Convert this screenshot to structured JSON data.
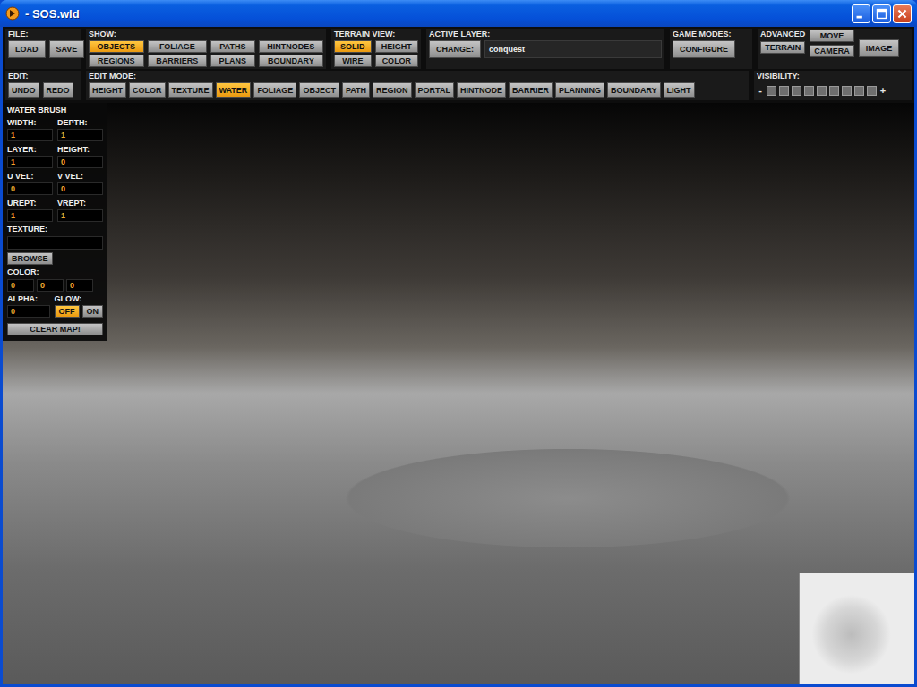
{
  "window": {
    "title": "- SOS.wld"
  },
  "toolbar": {
    "file": {
      "label": "FILE:",
      "buttons": [
        {
          "label": "LOAD"
        },
        {
          "label": "SAVE"
        }
      ]
    },
    "show": {
      "label": "SHOW:",
      "buttons": [
        {
          "label": "OBJECTS",
          "selected": true
        },
        {
          "label": "FOLIAGE",
          "selected": false
        },
        {
          "label": "PATHS",
          "selected": false
        },
        {
          "label": "HINTNODES",
          "selected": false
        },
        {
          "label": "REGIONS",
          "selected": false
        },
        {
          "label": "BARRIERS",
          "selected": false
        },
        {
          "label": "PLANS",
          "selected": false
        },
        {
          "label": "BOUNDARY",
          "selected": false
        }
      ]
    },
    "terrain_view": {
      "label": "TERRAIN VIEW:",
      "buttons": [
        {
          "label": "SOLID",
          "selected": true
        },
        {
          "label": "HEIGHT",
          "selected": false
        },
        {
          "label": "WIRE",
          "selected": false
        },
        {
          "label": "COLOR",
          "selected": false
        }
      ]
    },
    "active_layer": {
      "label": "ACTIVE LAYER:",
      "change": "CHANGE:",
      "value": "conquest"
    },
    "game_modes": {
      "label": "GAME MODES:",
      "button": "CONFIGURE"
    },
    "advanced": {
      "label": "ADVANCED",
      "terrain": "TERRAIN",
      "move": "MOVE",
      "camera": "CAMERA",
      "image": "IMAGE"
    },
    "edit": {
      "label": "EDIT:",
      "buttons": [
        {
          "label": "UNDO"
        },
        {
          "label": "REDO"
        }
      ]
    },
    "edit_mode": {
      "label": "EDIT MODE:",
      "buttons": [
        {
          "label": "HEIGHT",
          "selected": false
        },
        {
          "label": "COLOR",
          "selected": false
        },
        {
          "label": "TEXTURE",
          "selected": false
        },
        {
          "label": "WATER",
          "selected": true
        },
        {
          "label": "FOLIAGE",
          "selected": false
        },
        {
          "label": "OBJECT",
          "selected": false
        },
        {
          "label": "PATH",
          "selected": false
        },
        {
          "label": "REGION",
          "selected": false
        },
        {
          "label": "PORTAL",
          "selected": false
        },
        {
          "label": "HINTNODE",
          "selected": false
        },
        {
          "label": "BARRIER",
          "selected": false
        },
        {
          "label": "PLANNING",
          "selected": false
        },
        {
          "label": "BOUNDARY",
          "selected": false
        },
        {
          "label": "LIGHT",
          "selected": false
        }
      ]
    },
    "visibility": {
      "label": "VISIBILITY:",
      "minus": "-",
      "plus": "+",
      "segments": [
        {
          "filled": false
        },
        {
          "filled": false
        },
        {
          "filled": false
        },
        {
          "filled": false
        },
        {
          "filled": false
        },
        {
          "filled": false
        },
        {
          "filled": false
        },
        {
          "filled": false
        },
        {
          "filled": false
        }
      ]
    }
  },
  "water_brush": {
    "title": "WATER BRUSH",
    "fields": [
      {
        "label": "WIDTH:",
        "value": "1"
      },
      {
        "label": "DEPTH:",
        "value": "1"
      },
      {
        "label": "LAYER:",
        "value": "1"
      },
      {
        "label": "HEIGHT:",
        "value": "0"
      },
      {
        "label": "U VEL:",
        "value": "0"
      },
      {
        "label": "V VEL:",
        "value": "0"
      },
      {
        "label": "UREPT:",
        "value": "1"
      },
      {
        "label": "VREPT:",
        "value": "1"
      }
    ],
    "texture": {
      "label": "TEXTURE:"
    },
    "browse": "BROWSE",
    "color": {
      "label": "COLOR:",
      "values": [
        "0",
        "0",
        "0"
      ]
    },
    "alpha": {
      "label": "ALPHA:",
      "value": "0"
    },
    "glow": {
      "label": "GLOW:",
      "options": [
        {
          "label": "OFF",
          "selected": true
        },
        {
          "label": "ON",
          "selected": false
        }
      ]
    },
    "clear": "CLEAR MAP!"
  }
}
